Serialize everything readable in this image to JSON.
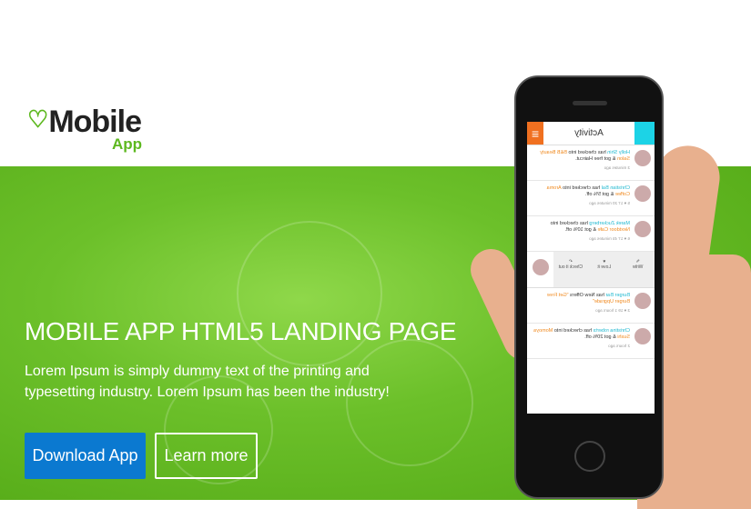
{
  "logo": {
    "name": "Mobile",
    "sub": "App",
    "icon": "heart-icon"
  },
  "hero": {
    "title": "MOBILE APP HTML5 LANDING PAGE",
    "description": "Lorem Ipsum is simply dummy text of the printing and typesetting industry. Lorem Ipsum has been the industry!",
    "download_label": "Download App",
    "learn_label": "Learn more"
  },
  "colors": {
    "green": "#5db81f",
    "blue": "#0b79d0",
    "orange": "#f07020",
    "cyan": "#1cd3e6"
  },
  "phone": {
    "title": "Activity",
    "feed": [
      {
        "name": "Holly Shin",
        "mid": " has checked into ",
        "place": "B&B Beauty Salon",
        "end": " & got free Haircut.",
        "time": "3 minutes ago",
        "stats": ""
      },
      {
        "name": "Christian Bal",
        "mid": " has checked into ",
        "place": "Aroma Coffee",
        "end": " & got 5% off.",
        "time": "20 minutes ago",
        "stats": "5 ♥ 17"
      },
      {
        "name": "Marek Zuckerberg",
        "mid": " has checked into ",
        "place": "Nextdoor Cafe",
        "end": " & got 10% off.",
        "time": "45 minutes ago",
        "stats": "6 ♥ 17"
      }
    ],
    "actions": [
      "Write",
      "Love it",
      "Check it out"
    ],
    "feed2": [
      {
        "name": "Burger Bar",
        "mid": " has New Offers ",
        "place": "\"Get Free Burger Upgrade\"",
        "end": "",
        "time": "1 hours ago",
        "stats": "3 ♥ 19"
      },
      {
        "name": "Christina roberts",
        "mid": " has checked into ",
        "place": "Momoya Sushi",
        "end": " & got 20% off.",
        "time": "2 hours ago",
        "stats": ""
      }
    ]
  }
}
